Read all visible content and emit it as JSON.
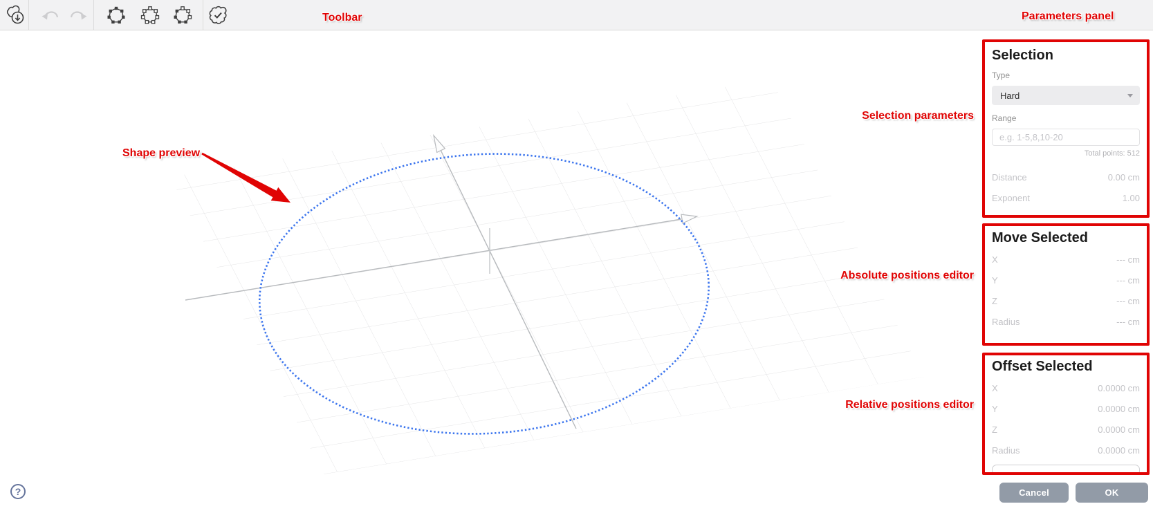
{
  "annotations": {
    "accent_color": "#e00404",
    "toolbar": "Toolbar",
    "parameters_panel": "Parameters panel",
    "selection_parameters": "Selection parameters",
    "shape_preview": "Shape preview",
    "absolute_positions": "Absolute positions editor",
    "relative_positions": "Relative positions editor"
  },
  "toolbar_icons": [
    {
      "name": "export-points-icon"
    },
    {
      "name": "undo-icon",
      "disabled": true
    },
    {
      "name": "redo-icon",
      "disabled": true
    },
    {
      "name": "select-all-points-icon"
    },
    {
      "name": "deselect-all-points-icon"
    },
    {
      "name": "invert-selection-icon"
    },
    {
      "name": "apply-selection-icon"
    }
  ],
  "viewport": {
    "shape": "dotted-circle",
    "point_color": "#3d76ee"
  },
  "panel": {
    "selection": {
      "title": "Selection",
      "type_label": "Type",
      "type_value": "Hard",
      "range_label": "Range",
      "range_placeholder": "e.g. 1-5,8,10-20",
      "total_points": "Total points: 512",
      "rows": [
        {
          "label": "Distance",
          "value": "0.00 cm"
        },
        {
          "label": "Exponent",
          "value": "1.00"
        }
      ]
    },
    "move": {
      "title": "Move Selected",
      "rows": [
        {
          "label": "X",
          "value": "--- cm"
        },
        {
          "label": "Y",
          "value": "--- cm"
        },
        {
          "label": "Z",
          "value": "--- cm"
        },
        {
          "label": "Radius",
          "value": "--- cm"
        }
      ]
    },
    "offset": {
      "title": "Offset Selected",
      "rows": [
        {
          "label": "X",
          "value": "0.0000 cm"
        },
        {
          "label": "Y",
          "value": "0.0000 cm"
        },
        {
          "label": "Z",
          "value": "0.0000 cm"
        },
        {
          "label": "Radius",
          "value": "0.0000 cm"
        }
      ]
    }
  },
  "footer": {
    "cancel": "Cancel",
    "ok": "OK",
    "help": "?"
  }
}
